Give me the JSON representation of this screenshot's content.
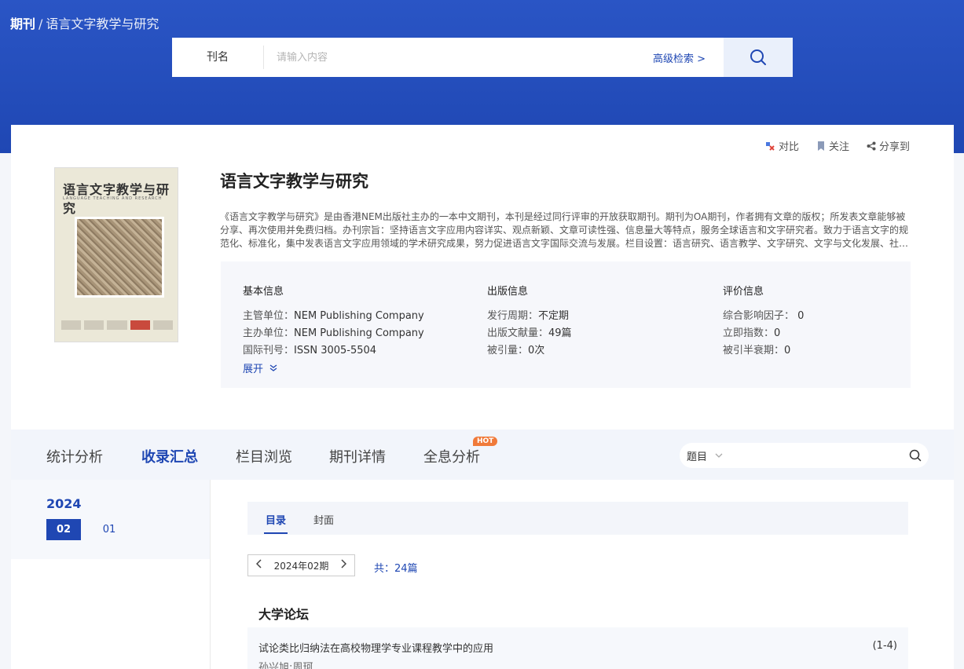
{
  "breadcrumb": {
    "root": "期刊",
    "separator": "/",
    "current": "语言文字教学与研究"
  },
  "search": {
    "type_label": "刊名",
    "placeholder": "请输入内容",
    "advanced_label": "高级检索 >"
  },
  "actions": {
    "compare": "对比",
    "follow": "关注",
    "share": "分享到"
  },
  "cover": {
    "title": "语言文字教学与研究",
    "subtitle": "LANGUAGE TEACHING AND RESEARCH"
  },
  "journal": {
    "title": "语言文字教学与研究",
    "description": "《语言文字教学与研究》是由香港NEM出版社主办的一本中文期刊，本刊是经过同行评审的开放获取期刊。期刊为OA期刊，作者拥有文章的版权；所发表文章能够被分享、再次使用并免费归档。办刊宗旨：坚持语言文字应用内容详实、观点新颖、文章可读性强、信息量大等特点，服务全球语言和文字研究者。致力于语言文字的规范化、标准化，集中发表语言文字应用领域的学术研究成果，努力促进语言文字国际交流与发展。栏目设置：语言研究、语言教学、文字研究、文字与文化发展、社会语言学等。"
  },
  "info": {
    "basic": {
      "title": "基本信息",
      "rows": [
        {
          "label": "主管单位：",
          "value": "NEM Publishing Company"
        },
        {
          "label": "主办单位：",
          "value": "NEM Publishing Company"
        },
        {
          "label": "国际刊号：",
          "value": "ISSN 3005-5504"
        }
      ]
    },
    "publish": {
      "title": "出版信息",
      "rows": [
        {
          "label": "发行周期：",
          "value": "不定期"
        },
        {
          "label": "出版文献量：",
          "value": "49篇"
        },
        {
          "label": "被引量：",
          "value": "0次"
        }
      ]
    },
    "evaluation": {
      "title": "评价信息",
      "rows": [
        {
          "label": "综合影响因子：",
          "value": "0"
        },
        {
          "label": "立即指数：",
          "value": "0"
        },
        {
          "label": "被引半衰期：",
          "value": "0"
        }
      ]
    },
    "expand_label": "展开"
  },
  "nav": {
    "tabs": [
      "统计分析",
      "收录汇总",
      "栏目浏览",
      "期刊详情",
      "全息分析"
    ],
    "active_index": 1,
    "hot_badge": "HOT",
    "search_type": "题目"
  },
  "sidebar": {
    "year": "2024",
    "issues": [
      "02",
      "01"
    ],
    "active_issue": "02"
  },
  "content": {
    "subtabs": [
      "目录",
      "封面"
    ],
    "issue_label": "2024年02期",
    "count_label": "共：24篇",
    "section_title": "大学论坛",
    "article": {
      "title": "试论类比归纳法在高校物理学专业课程教学中的应用",
      "pages": "(1-4)",
      "authors": "孙兴旭;周珂"
    }
  },
  "colors": {
    "primary": "#1f47b3",
    "hero": "#2a55c5",
    "hot": "#f07a3a"
  },
  "icons": [
    "search-icon",
    "compare-icon",
    "bookmark-icon",
    "share-icon",
    "chevron-down-icon",
    "chevron-left-icon",
    "chevron-right-icon"
  ]
}
